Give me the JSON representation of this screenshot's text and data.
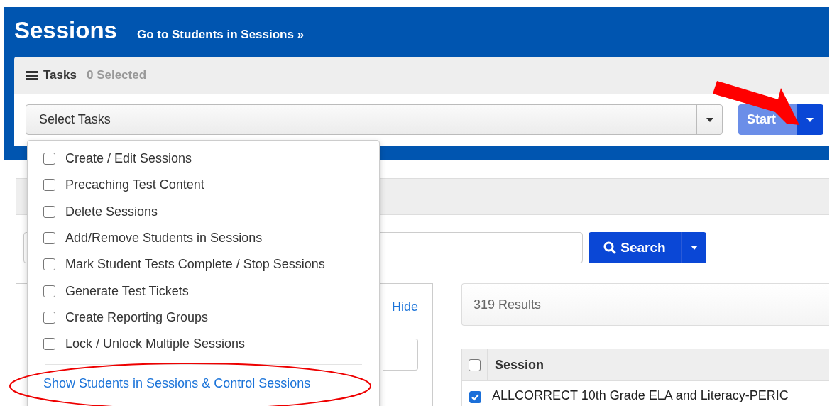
{
  "header": {
    "title": "Sessions",
    "link": "Go to Students in Sessions »"
  },
  "tasks": {
    "title": "Tasks",
    "selected_count": "0 Selected",
    "select_placeholder": "Select Tasks",
    "start_button": "Start"
  },
  "task_menu": {
    "items": [
      {
        "label": "Create / Edit Sessions",
        "checked": false
      },
      {
        "label": "Precaching Test Content",
        "checked": false
      },
      {
        "label": "Delete Sessions",
        "checked": false
      },
      {
        "label": "Add/Remove Students in Sessions",
        "checked": false
      },
      {
        "label": "Mark Student Tests Complete / Stop Sessions",
        "checked": false
      },
      {
        "label": "Generate Test Tickets",
        "checked": false
      },
      {
        "label": "Create Reporting Groups",
        "checked": false
      },
      {
        "label": "Lock / Unlock Multiple Sessions",
        "checked": false
      }
    ],
    "link": "Show Students in Sessions & Control Sessions"
  },
  "search": {
    "button": "Search"
  },
  "filters": {
    "hide_link": "Hide"
  },
  "results": {
    "count": "319 Results"
  },
  "table": {
    "columns": [
      "Session"
    ],
    "header_checked": false,
    "rows": [
      {
        "session": "ALLCORRECT 10th Grade ELA and Literacy-PERIC",
        "checked": true
      }
    ]
  }
}
